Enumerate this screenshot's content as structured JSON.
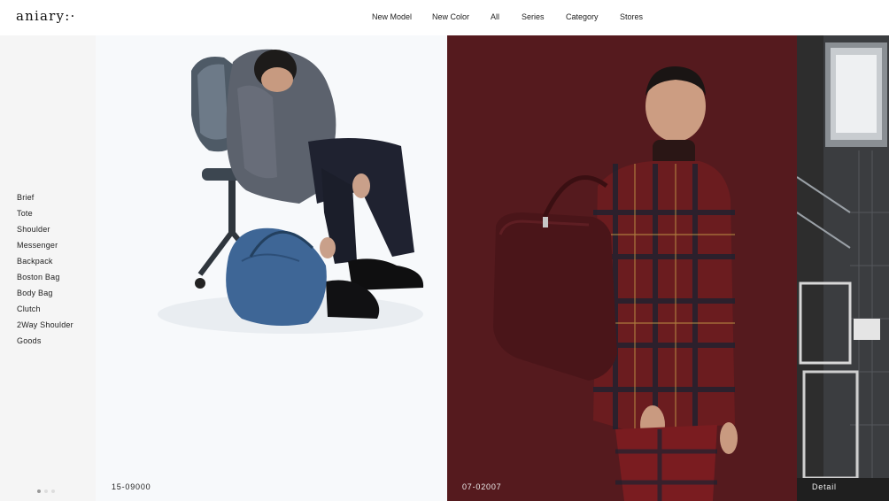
{
  "header": {
    "logo": "aniary:·",
    "nav": [
      {
        "label": "New Model"
      },
      {
        "label": "New Color"
      },
      {
        "label": "All"
      },
      {
        "label": "Series"
      },
      {
        "label": "Category"
      },
      {
        "label": "Stores"
      }
    ]
  },
  "sidebar": {
    "categories": [
      "Brief",
      "Tote",
      "Shoulder",
      "Messenger",
      "Backpack",
      "Boston Bag",
      "Body Bag",
      "Clutch",
      "2Way Shoulder",
      "Goods"
    ],
    "pager": {
      "total": 3,
      "active": 1
    }
  },
  "panels": [
    {
      "caption": "15-09000"
    },
    {
      "caption": "07-02007"
    },
    {
      "caption": "Detail"
    }
  ],
  "colors": {
    "panel1_bg": "#f7f9fb",
    "panel2_bg": "#5a1c20",
    "panel3_bg": "#2a2a2a",
    "sidebar_bg": "#f5f5f5"
  }
}
